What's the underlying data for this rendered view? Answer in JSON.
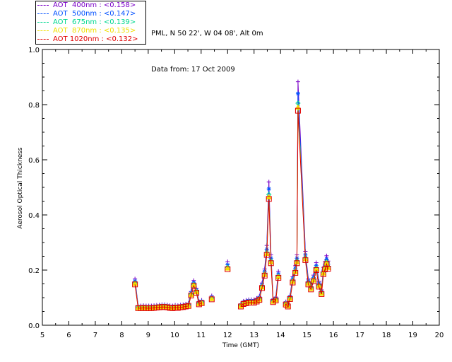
{
  "legend": [
    {
      "label": "AOT  400nm : <0.158>",
      "color": "#7a00c8"
    },
    {
      "label": "AOT  500nm : <0.147>",
      "color": "#0050ff"
    },
    {
      "label": "AOT  675nm : <0.139>",
      "color": "#00d890"
    },
    {
      "label": "AOT  870nm : <0.135>",
      "color": "#f0e000"
    },
    {
      "label": "AOT 1020nm : <0.132>",
      "color": "#e00000"
    }
  ],
  "header": {
    "site": "PML, N 50 22', W 04 08', Alt 0m",
    "date": "Data from: 17 Oct 2009"
  },
  "chart_data": {
    "type": "line",
    "xlabel": "Time (GMT)",
    "ylabel": "Aerosol Optical Thickness",
    "xlim": [
      5,
      20
    ],
    "ylim": [
      0,
      1.0
    ],
    "xticks": [
      "5",
      "6",
      "7",
      "8",
      "9",
      "10",
      "11",
      "12",
      "13",
      "14",
      "15",
      "16",
      "17",
      "18",
      "19",
      "20"
    ],
    "yticks": [
      "0.0",
      "0.2",
      "0.4",
      "0.6",
      "0.8",
      "1.0"
    ],
    "segments": [
      {
        "x": [
          8.5,
          8.62,
          8.72,
          8.82,
          8.92,
          9.02,
          9.12,
          9.22,
          9.32,
          9.42,
          9.52,
          9.62,
          9.72,
          9.82,
          9.92,
          10.02,
          10.12,
          10.22,
          10.32,
          10.42,
          10.52,
          10.62,
          10.72,
          10.82,
          10.92,
          11.02
        ],
        "y": [
          0.148,
          0.062,
          0.062,
          0.063,
          0.062,
          0.062,
          0.062,
          0.063,
          0.064,
          0.065,
          0.066,
          0.066,
          0.065,
          0.063,
          0.062,
          0.064,
          0.063,
          0.065,
          0.066,
          0.068,
          0.07,
          0.108,
          0.143,
          0.118,
          0.076,
          0.08
        ]
      },
      {
        "x": [
          11.4
        ],
        "y": [
          0.094
        ]
      },
      {
        "x": [
          12.0
        ],
        "y": [
          0.203
        ]
      },
      {
        "x": [
          12.5,
          12.6,
          12.7,
          12.8,
          12.9,
          13.0,
          13.1,
          13.2,
          13.3,
          13.4,
          13.48,
          13.56,
          13.64,
          13.72,
          13.82,
          13.92
        ],
        "y": [
          0.068,
          0.077,
          0.08,
          0.082,
          0.082,
          0.082,
          0.086,
          0.092,
          0.135,
          0.18,
          0.255,
          0.458,
          0.225,
          0.084,
          0.09,
          0.172
        ]
      },
      {
        "x": [
          14.2,
          14.28,
          14.36,
          14.46,
          14.56,
          14.62,
          14.66,
          14.94,
          15.05,
          15.15,
          15.25,
          15.35,
          15.45,
          15.55,
          15.62,
          15.68,
          15.74,
          15.8
        ],
        "y": [
          0.075,
          0.068,
          0.095,
          0.155,
          0.19,
          0.225,
          0.778,
          0.236,
          0.148,
          0.13,
          0.16,
          0.2,
          0.14,
          0.113,
          0.185,
          0.203,
          0.222,
          0.205
        ]
      }
    ],
    "series": [
      {
        "name": "AOT 400nm",
        "offset": 0.027,
        "marker": "plus"
      },
      {
        "name": "AOT 500nm",
        "offset": 0.016,
        "marker": "star"
      },
      {
        "name": "AOT 675nm",
        "offset": 0.007,
        "marker": "diamond"
      },
      {
        "name": "AOT 870nm",
        "offset": 0.003,
        "marker": "triangle"
      },
      {
        "name": "AOT 1020nm",
        "offset": 0.0,
        "marker": "square"
      }
    ]
  }
}
